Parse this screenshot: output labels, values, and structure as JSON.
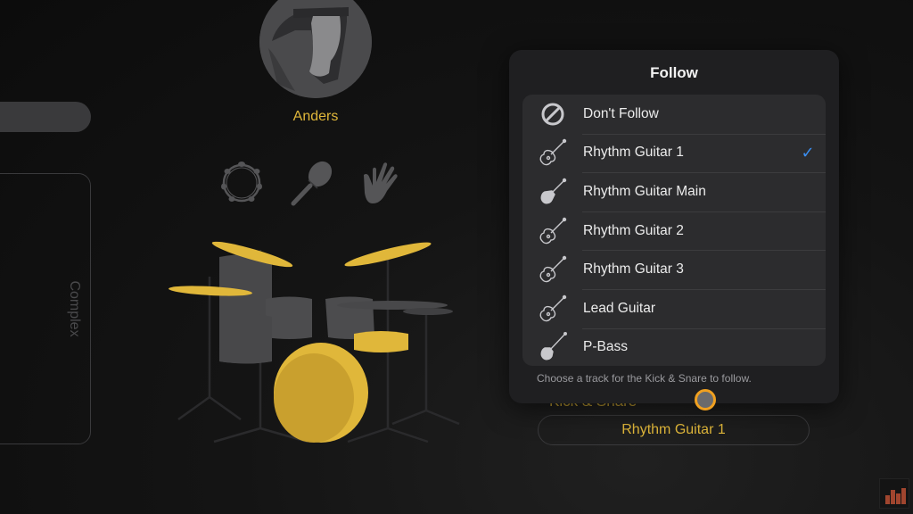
{
  "left_panel": {
    "complex_label": "Complex"
  },
  "drummer": {
    "name": "Anders",
    "avatar_icon": "drummer-avatar",
    "percussion_icons": [
      "tambourine-icon",
      "shaker-icon",
      "handclap-icon"
    ]
  },
  "drum_kit": {
    "highlighted_color": "#e0b73a",
    "inactive_color": "#48484a",
    "active_pieces": [
      "crash-left",
      "crash-right",
      "ride",
      "snare",
      "kick"
    ],
    "inactive_pieces": [
      "tom-1",
      "tom-2",
      "floor-tom",
      "hi-hat"
    ]
  },
  "popover": {
    "title": "Follow",
    "items": [
      {
        "label": "Don't Follow",
        "icon": "prohibited-icon",
        "selected": false
      },
      {
        "label": "Rhythm Guitar 1",
        "icon": "acoustic-electric-guitar-icon",
        "selected": true
      },
      {
        "label": "Rhythm Guitar Main",
        "icon": "electric-guitar-icon",
        "selected": false
      },
      {
        "label": "Rhythm Guitar 2",
        "icon": "acoustic-electric-guitar-icon",
        "selected": false
      },
      {
        "label": "Rhythm Guitar 3",
        "icon": "acoustic-electric-guitar-icon",
        "selected": false
      },
      {
        "label": "Lead Guitar",
        "icon": "acoustic-electric-guitar-icon",
        "selected": false
      },
      {
        "label": "P-Bass",
        "icon": "bass-guitar-icon",
        "selected": false
      }
    ],
    "checkmark": "✓",
    "footer": "Choose a track for the Kick & Snare to follow."
  },
  "follow_section": {
    "label": "Kick & Snare",
    "button_value": "Rhythm Guitar 1"
  },
  "colors": {
    "accent_gold": "#e0b73a",
    "check_blue": "#3b8ef0",
    "touch_ring": "#f0a020"
  }
}
